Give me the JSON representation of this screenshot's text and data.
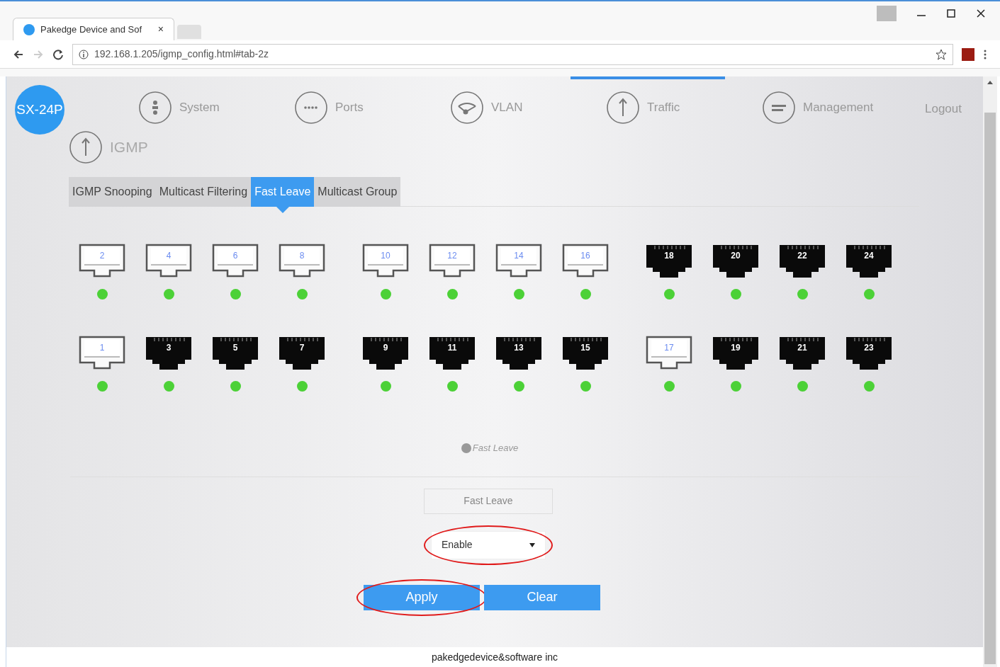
{
  "browser": {
    "tab_title": "Pakedge Device and Sof",
    "tab_close": "×",
    "url": "192.168.1.205/igmp_config.html#tab-2z"
  },
  "logo": "SX-24P",
  "nav": [
    {
      "label": "System",
      "kind": "system",
      "selected": false
    },
    {
      "label": "Ports",
      "kind": "ports",
      "selected": false
    },
    {
      "label": "VLAN",
      "kind": "vlan",
      "selected": false
    },
    {
      "label": "Traffic",
      "kind": "traffic",
      "selected": true
    },
    {
      "label": "Management",
      "kind": "management",
      "selected": false
    }
  ],
  "logout": "Logout",
  "section": "IGMP",
  "tabs": [
    {
      "label": "IGMP Snooping",
      "selected": false
    },
    {
      "label": "Multicast Filtering",
      "selected": false
    },
    {
      "label": "Fast Leave",
      "selected": true
    },
    {
      "label": "Multicast Group",
      "selected": false
    }
  ],
  "port_rows": [
    [
      {
        "label": "2",
        "selected": true,
        "link_up": true
      },
      {
        "label": "4",
        "selected": true,
        "link_up": true
      },
      {
        "label": "6",
        "selected": true,
        "link_up": true
      },
      {
        "label": "8",
        "selected": true,
        "link_up": true
      },
      {
        "label": "10",
        "selected": true,
        "link_up": true
      },
      {
        "label": "12",
        "selected": true,
        "link_up": true
      },
      {
        "label": "14",
        "selected": true,
        "link_up": true
      },
      {
        "label": "16",
        "selected": true,
        "link_up": true
      },
      {
        "label": "18",
        "selected": false,
        "link_up": true
      },
      {
        "label": "20",
        "selected": false,
        "link_up": true
      },
      {
        "label": "22",
        "selected": false,
        "link_up": true
      },
      {
        "label": "24",
        "selected": false,
        "link_up": true
      }
    ],
    [
      {
        "label": "1",
        "selected": true,
        "link_up": true
      },
      {
        "label": "3",
        "selected": false,
        "link_up": true
      },
      {
        "label": "5",
        "selected": false,
        "link_up": true
      },
      {
        "label": "7",
        "selected": false,
        "link_up": true
      },
      {
        "label": "9",
        "selected": false,
        "link_up": true
      },
      {
        "label": "11",
        "selected": false,
        "link_up": true
      },
      {
        "label": "13",
        "selected": false,
        "link_up": true
      },
      {
        "label": "15",
        "selected": false,
        "link_up": true
      },
      {
        "label": "17",
        "selected": true,
        "link_up": true
      },
      {
        "label": "19",
        "selected": false,
        "link_up": true
      },
      {
        "label": "21",
        "selected": false,
        "link_up": true
      },
      {
        "label": "23",
        "selected": false,
        "link_up": true
      }
    ]
  ],
  "legend": "Fast Leave",
  "form": {
    "label": "Fast Leave",
    "select": {
      "value": "Enable",
      "circled": true
    }
  },
  "buttons": [
    {
      "label": "Apply",
      "circled": true
    },
    {
      "label": "Clear",
      "circled": false
    }
  ],
  "footer": "pakedgedevice&software inc"
}
